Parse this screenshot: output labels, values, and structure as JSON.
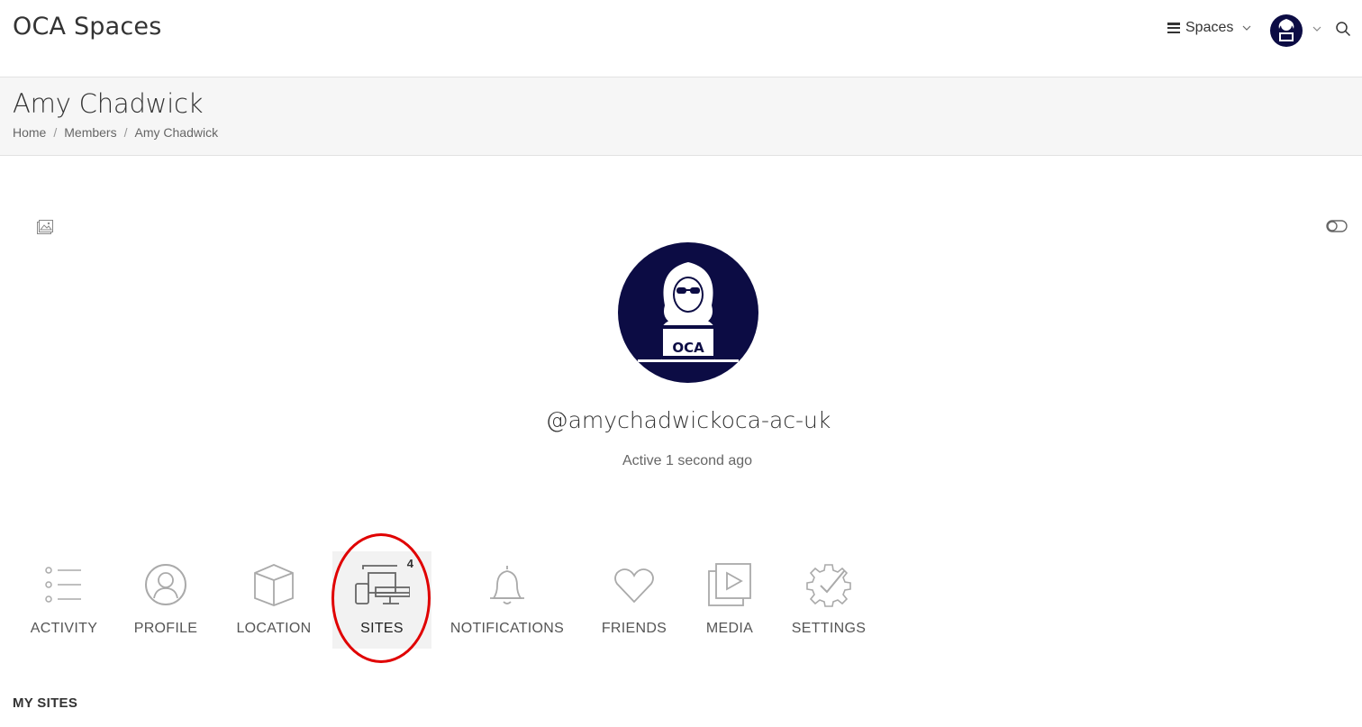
{
  "header": {
    "site_title": "OCA Spaces",
    "spaces_label": "Spaces"
  },
  "title_band": {
    "page_title": "Amy Chadwick",
    "breadcrumb": [
      "Home",
      "Members",
      "Amy Chadwick"
    ]
  },
  "profile": {
    "username": "@amychadwickoca-ac-uk",
    "status": "Active 1 second ago"
  },
  "nav": {
    "items": [
      {
        "label": "ACTIVITY",
        "icon": "list-icon"
      },
      {
        "label": "PROFILE",
        "icon": "user-icon"
      },
      {
        "label": "LOCATION",
        "icon": "cube-icon"
      },
      {
        "label": "SITES",
        "icon": "devices-icon",
        "badge": "4",
        "active": true
      },
      {
        "label": "NOTIFICATIONS",
        "icon": "bell-icon"
      },
      {
        "label": "FRIENDS",
        "icon": "heart-icon"
      },
      {
        "label": "MEDIA",
        "icon": "media-icon"
      },
      {
        "label": "SETTINGS",
        "icon": "gear-icon"
      }
    ]
  },
  "section": {
    "title": "MY SITES"
  },
  "colors": {
    "avatar_bg": "#0c0c44",
    "annotation": "#e00000",
    "icon_gray": "#aaaaaa"
  }
}
